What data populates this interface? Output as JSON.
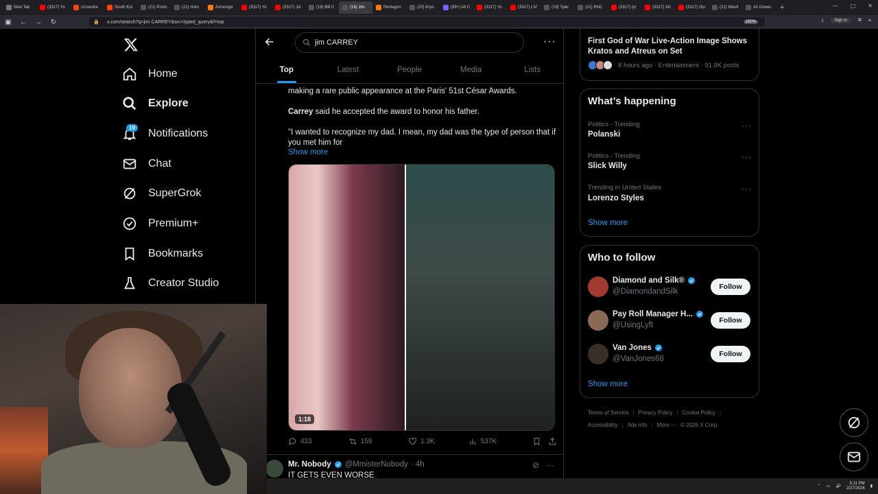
{
  "browser": {
    "tabs": [
      {
        "label": "New Tab",
        "color": "#777777"
      },
      {
        "label": "(3317) Yo",
        "color": "#ff0000"
      },
      {
        "label": "r/Livestre",
        "color": "#ff4500"
      },
      {
        "label": "South Kor",
        "color": "#ff4500"
      },
      {
        "label": "(21) Posts",
        "color": "#555555"
      },
      {
        "label": "(21) Hom",
        "color": "#555555"
      },
      {
        "label": "Asmongo",
        "color": "#ff7a00"
      },
      {
        "label": "(3317) Yo",
        "color": "#ff0000"
      },
      {
        "label": "(3317) Jol",
        "color": "#ff0000"
      },
      {
        "label": "(19) Bill C",
        "color": "#555555"
      },
      {
        "label": "(19) Jim",
        "color": "#555555"
      },
      {
        "label": "Pentagon",
        "color": "#ff7a00"
      },
      {
        "label": "(20) Kryo",
        "color": "#555555"
      },
      {
        "label": "(99+) All C",
        "color": "#7b61ff"
      },
      {
        "label": "(3317) Yo",
        "color": "#ff0000"
      },
      {
        "label": "(3317) LIV",
        "color": "#ff0000"
      },
      {
        "label": "(19) Tyler",
        "color": "#555555"
      },
      {
        "label": "(21) RNC",
        "color": "#555555"
      },
      {
        "label": "(3317) tyl",
        "color": "#ff0000"
      },
      {
        "label": "(3317) Vic",
        "color": "#ff0000"
      },
      {
        "label": "(3317) Stu",
        "color": "#ff0000"
      },
      {
        "label": "(21) Westl",
        "color": "#555555"
      },
      {
        "label": "Ari Drews",
        "color": "#555555"
      }
    ],
    "active_tab_index": 10,
    "url": "x.com/search?q=jim CARREY&src=typed_query&f=top",
    "zoom": "150%",
    "sign_in": "Sign in"
  },
  "sidebar": {
    "items": [
      {
        "label": "Home",
        "icon": "home-icon"
      },
      {
        "label": "Explore",
        "icon": "search-icon"
      },
      {
        "label": "Notifications",
        "icon": "bell-icon"
      },
      {
        "label": "Chat",
        "icon": "mail-icon"
      },
      {
        "label": "SuperGrok",
        "icon": "grok-icon"
      },
      {
        "label": "Premium+",
        "icon": "verified-icon"
      },
      {
        "label": "Bookmarks",
        "icon": "bookmark-icon"
      },
      {
        "label": "Creator Studio",
        "icon": "flask-icon"
      }
    ],
    "notification_count": "19"
  },
  "search": {
    "query": "jim CARREY",
    "tabs": [
      "Top",
      "Latest",
      "People",
      "Media",
      "Lists"
    ]
  },
  "post": {
    "text_line1": "making a rare public appearance at the Paris' 51st César Awards.",
    "text_bold": "Carrey",
    "text_line2": " said he accepted the award to honor his father.",
    "text_line3": "\"I wanted to recognize my dad. I mean, my dad was the type of person that if you met him for",
    "show_more": "Show more",
    "video_duration": "1:18",
    "replies": "433",
    "reposts": "159",
    "likes": "1.3K",
    "views": "537K"
  },
  "post2": {
    "name": "Mr. Nobody",
    "handle": "@MmisterNobody",
    "time": "· 4h",
    "text": "IT GETS EVEN WORSE"
  },
  "right": {
    "top_trend_title": "First God of War Live-Action Image Shows Kratos and Atreus on Set",
    "top_trend_meta": "8 hours ago · Entertainment · 91.9K posts",
    "happening_title": "What’s happening",
    "trends": [
      {
        "category": "Politics · Trending",
        "name": "Polanski"
      },
      {
        "category": "Politics · Trending",
        "name": "Slick Willy"
      },
      {
        "category": "Trending in United States",
        "name": "Lorenzo Styles"
      }
    ],
    "show_more": "Show more",
    "wtf_title": "Who to follow",
    "follow": [
      {
        "name": "Diamond and Silk®",
        "handle": "@DiamondandSilk",
        "avatar_color": "#a33a2f"
      },
      {
        "name": "Pay Roll Manager H...",
        "handle": "@UsingLyft",
        "avatar_color": "#8a6a55"
      },
      {
        "name": "Van Jones",
        "handle": "@VanJones68",
        "avatar_color": "#3b2f2a"
      }
    ],
    "follow_label": "Follow",
    "wtf_show_more": "Show more",
    "footer": [
      "Terms of Service",
      "Privacy Policy",
      "Cookie Policy",
      "Accessibility",
      "Ads info",
      "More ···",
      "© 2026 X Corp."
    ]
  },
  "taskbar": {
    "time": "5:11 PM",
    "date": "2/27/2026"
  },
  "colors": {
    "accent": "#1d9bf0",
    "background": "#000000",
    "border": "#2f3336",
    "muted": "#71767b"
  }
}
